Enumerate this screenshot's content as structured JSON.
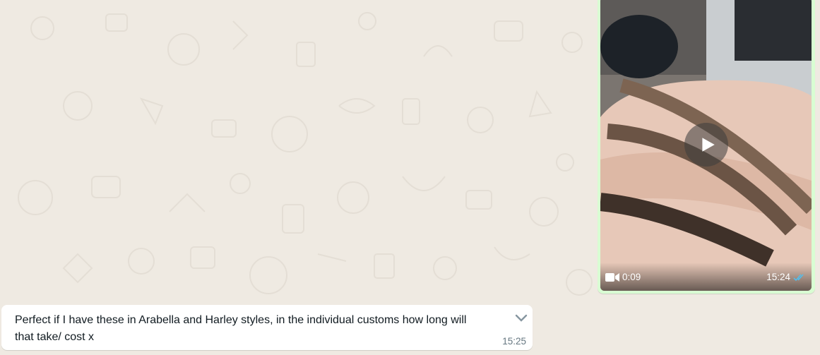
{
  "outgoing_video": {
    "duration": "0:09",
    "time": "15:24",
    "status": "read",
    "icons": [
      "play-icon",
      "video-camera-icon",
      "double-check-icon"
    ]
  },
  "incoming_message": {
    "line1": "Perfect if I have these in Arabella and Harley styles, in the individual customs how long will",
    "line2": "that take/ cost x",
    "time": "15:25",
    "icons": [
      "chevron-down-icon"
    ]
  },
  "colors": {
    "chat_background": "#efeae2",
    "outgoing_bubble": "#d9fdd3",
    "incoming_bubble": "#ffffff",
    "read_ticks": "#53bdeb",
    "timestamp": "#667781"
  }
}
